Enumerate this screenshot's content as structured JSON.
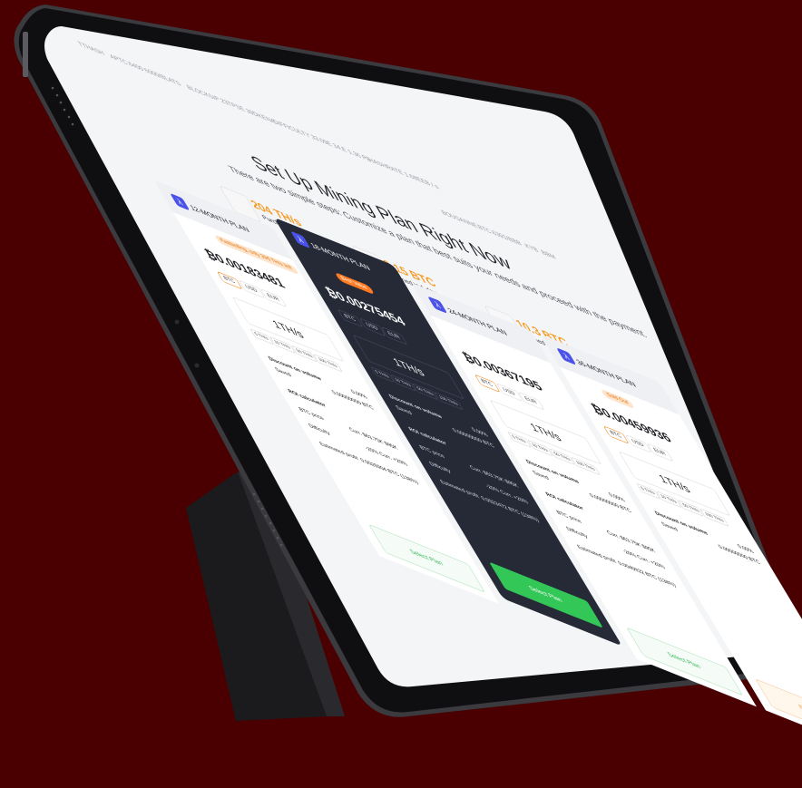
{
  "colors": {
    "background": "#4a0000",
    "accent_orange": "#f59a23",
    "green": "#33c758",
    "dark_card": "#262a37",
    "brand_blue": "#4a52e8"
  },
  "topbar": {
    "left": [
      "TTHASH",
      "APTC:6400 6000/BLATS",
      "BLOCKSIP 23TPSE 39DKENA",
      "DIFFICULTY 33.09E 34.E 1.36 PB",
      "HASHRATE 1.68EEB / s"
    ],
    "right": [
      "BOUSANNE",
      "BTC:6391/BBB",
      "KYB",
      "BBM"
    ]
  },
  "heading": {
    "title": "Set Up Mining Plan Right Now",
    "subtitle": "There are two simple steps: Customize a plan that best suits your needs and proceed with the payment."
  },
  "stats": [
    {
      "value": "204 TH/s",
      "label": "Purchased (last 24h)",
      "icon": "chart-icon"
    },
    {
      "value": "2.15 BTC",
      "label": "Mined in 1 day",
      "icon": "hand-coin-icon"
    },
    {
      "value": "10.3 BTC",
      "label": "Mined in 7 days",
      "icon": "crate-icon"
    }
  ],
  "plans": [
    {
      "name": "12-MONTH PLAN",
      "badge": "Fastselling, only 396 TH/s left",
      "price": "0.00183481",
      "hashrate": "1TH/s",
      "discount_label": "Discount on volume",
      "discount": "0.00%",
      "saved_label": "Saved",
      "saved": "0.00000000 BTC",
      "roi": "ROI calculator",
      "btc_price_label": "BTC price",
      "difficulty_label": "Difficulty",
      "profit_label": "Estimated profit",
      "profit": "0.0026904 BTC (138%)",
      "button": "Select Plan"
    },
    {
      "name": "18-MONTH PLAN",
      "badge": "Best Value",
      "price": "0.00275454",
      "hashrate": "1TH/s",
      "discount_label": "Discount on volume",
      "discount": "0.00%",
      "saved_label": "Saved",
      "saved": "0.00000000 BTC",
      "roi": "ROI calculator",
      "btc_price_label": "BTC price",
      "difficulty_label": "Difficulty",
      "profit_label": "Estimated profit",
      "profit": "0.0023472 BTC (138%)",
      "button": "Select Plan"
    },
    {
      "name": "24-MONTH PLAN",
      "badge": "",
      "price": "0.00367195",
      "hashrate": "1TH/s",
      "discount_label": "Discount on volume",
      "discount": "0.00%",
      "saved_label": "Saved",
      "saved": "0.00000000 BTC",
      "roi": "ROI calculator",
      "btc_price_label": "BTC price",
      "difficulty_label": "Difficulty",
      "profit_label": "Estimated profit",
      "profit": "0.0040922 BTC (138%)",
      "button": "Select Plan"
    },
    {
      "name": "36-MONTH PLAN",
      "badge": "Sold Out",
      "price": "0.00459936",
      "hashrate": "1TH/s",
      "discount_label": "Discount on volume",
      "discount": "0.00%",
      "saved_label": "Saved",
      "saved": "0.00000000 BTC",
      "roi": "",
      "btc_price_label": "",
      "difficulty_label": "",
      "profit_label": "",
      "profit": "",
      "button": "Notify Me"
    }
  ],
  "currencies": [
    "BTC",
    "USD",
    "EUR"
  ],
  "hashrate_chips": [
    "5 TH/s",
    "10 TH/s",
    "50 TH/s",
    "100 TH/s"
  ],
  "roi_options": {
    "btc_price": [
      "Curr.",
      "$63.75K",
      "$95K"
    ],
    "difficulty": [
      "-20%",
      "Curr.",
      "+20%"
    ]
  }
}
